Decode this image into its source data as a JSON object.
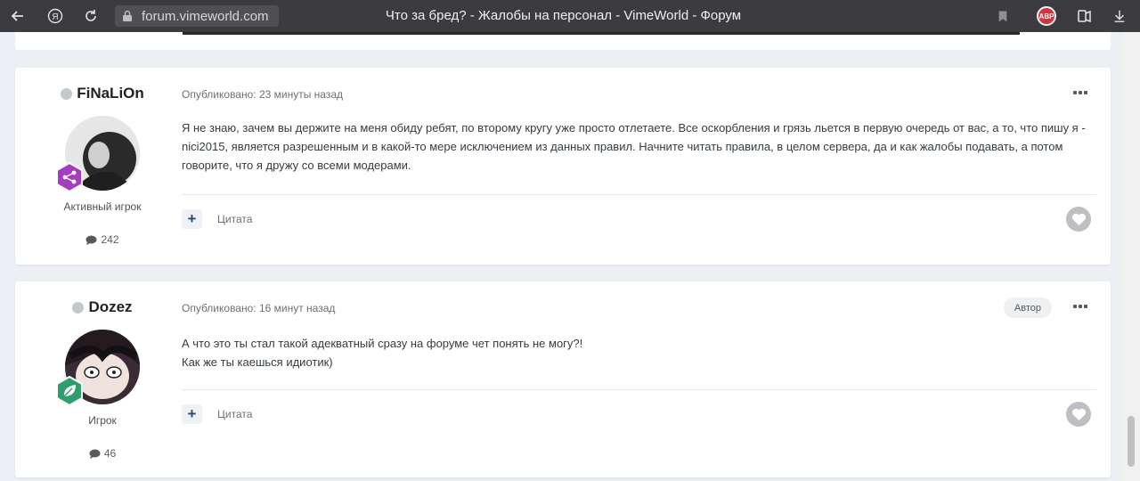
{
  "browser": {
    "url": "forum.vimeworld.com",
    "tab_title": "Что за бред? - Жалобы на персонал - VimeWorld - Форум",
    "adblock_label": "ABP"
  },
  "posts": [
    {
      "author": "FiNaLiOn",
      "rank": "Активный игрок",
      "post_count": "242",
      "meta": "Опубликовано: 23 минуты назад",
      "badge": "",
      "content": [
        "Я не знаю, зачем вы держите на меня обиду ребят, по второму кругу уже просто отлетаете. Все оскорбления и грязь льется в первую очередь от вас, а то, что пишу я - nici2015, является разрешенным и в какой-то мере исключением из данных правил. Начните читать правила, в целом сервера, да и как жалобы подавать, а потом говорите, что я дружу со всеми модерами."
      ],
      "quote_label": "Цитата",
      "rank_color": "#a43dbf"
    },
    {
      "author": "Dozez",
      "rank": "Игрок",
      "post_count": "46",
      "meta": "Опубликовано: 16 минут назад",
      "badge": "Автор",
      "content": [
        "А что это ты стал такой адекватный сразу на форуме чет понять не могу?!",
        "Как же ты каешься идиотик)"
      ],
      "quote_label": "Цитата",
      "rank_color": "#2f9e6e"
    }
  ]
}
